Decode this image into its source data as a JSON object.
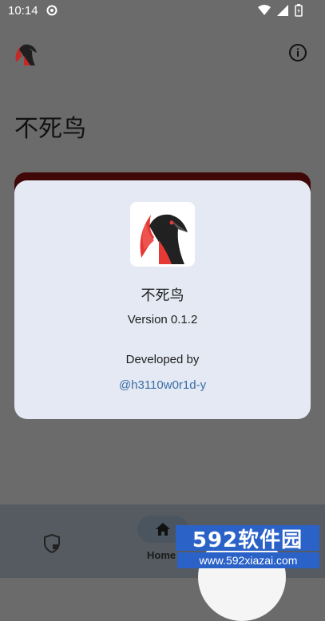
{
  "status_bar": {
    "time": "10:14"
  },
  "app_bar": {
    "logo_icon": "phoenix-logo-icon",
    "info_icon": "info-icon"
  },
  "page": {
    "title": "不死鸟"
  },
  "dialog": {
    "app_name": "不死鸟",
    "version": "Version 0.1.2",
    "developed_by_label": "Developed by",
    "developer_handle": "@h3110w0r1d-y"
  },
  "bottom_nav": {
    "items": [
      {
        "icon": "shield-lock-icon",
        "label": ""
      },
      {
        "icon": "home-icon",
        "label": "Home"
      }
    ]
  },
  "watermark": {
    "title": "592软件园",
    "url": "www.592xiazai.com"
  },
  "colors": {
    "dialog_bg": "#e4e9f3",
    "accent_red": "#e53935",
    "link": "#3a6ea5"
  }
}
